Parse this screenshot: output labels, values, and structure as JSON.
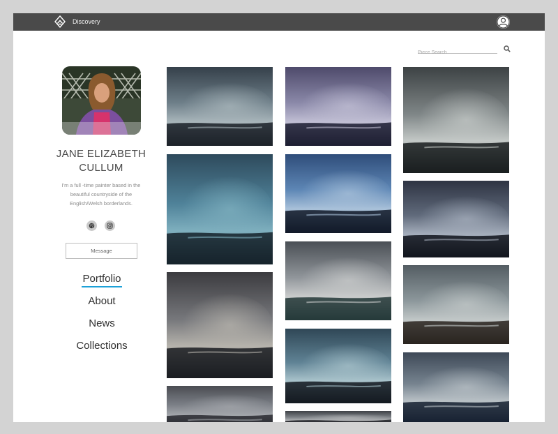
{
  "header": {
    "app_title": "Discovery",
    "logo_icon": "diamond-arrow-logo",
    "account_icon": "user-avatar-icon"
  },
  "search": {
    "placeholder": "Piece Search",
    "icon": "search-icon"
  },
  "profile": {
    "name_line1": "JANE ELIZABETH",
    "name_line2": "CULLUM",
    "bio_line1": "I'm a full -time painter based in the",
    "bio_line2": "beautiful countryside of the",
    "bio_line3": "English/Welsh borderlands.",
    "social_icons": [
      "globe-icon",
      "instagram-icon"
    ],
    "message_label": "Message"
  },
  "nav": {
    "items": [
      {
        "label": "Portfolio",
        "active": true
      },
      {
        "label": "About",
        "active": false
      },
      {
        "label": "News",
        "active": false
      },
      {
        "label": "Collections",
        "active": false
      }
    ],
    "active_color": "#1da1d8"
  },
  "gallery": {
    "columns": [
      {
        "tiles": [
          {
            "palette": [
              "#35404a",
              "#6d7e88",
              "#a9b6bb",
              "#1c2229"
            ]
          },
          {
            "palette": [
              "#2e4a5c",
              "#4f8299",
              "#7fb0bf",
              "#16232c"
            ]
          },
          {
            "palette": [
              "#3b3b3f",
              "#77787c",
              "#b6b3ac",
              "#1b1d22"
            ]
          },
          {
            "palette": [
              "#4a4c52",
              "#7b7f86",
              "#a3a6ab",
              "#2a2c31"
            ]
          }
        ]
      },
      {
        "tiles": [
          {
            "palette": [
              "#4e4a6b",
              "#8a88a8",
              "#c1bfd4",
              "#1d1f33"
            ]
          },
          {
            "palette": [
              "#2f4d7a",
              "#5d86b5",
              "#aac2da",
              "#121a29"
            ]
          },
          {
            "palette": [
              "#4a4f55",
              "#8f9499",
              "#c9cbcb",
              "#263a3a"
            ]
          },
          {
            "palette": [
              "#2f4756",
              "#5f8294",
              "#a9c3cb",
              "#141a21"
            ]
          },
          {
            "palette": [
              "#3e4146",
              "#7d8186",
              "#b4b6b8",
              "#1e2024"
            ]
          }
        ]
      },
      {
        "tiles": [
          {
            "palette": [
              "#3d4244",
              "#808788",
              "#c4c9c7",
              "#1a1e20"
            ]
          },
          {
            "palette": [
              "#2e3443",
              "#606a7b",
              "#a6afbd",
              "#12151d"
            ]
          },
          {
            "palette": [
              "#545d63",
              "#8c979b",
              "#c2c8c8",
              "#2a2420"
            ]
          },
          {
            "palette": [
              "#3e4957",
              "#76838f",
              "#b9c1c6",
              "#182233"
            ]
          }
        ]
      }
    ]
  }
}
